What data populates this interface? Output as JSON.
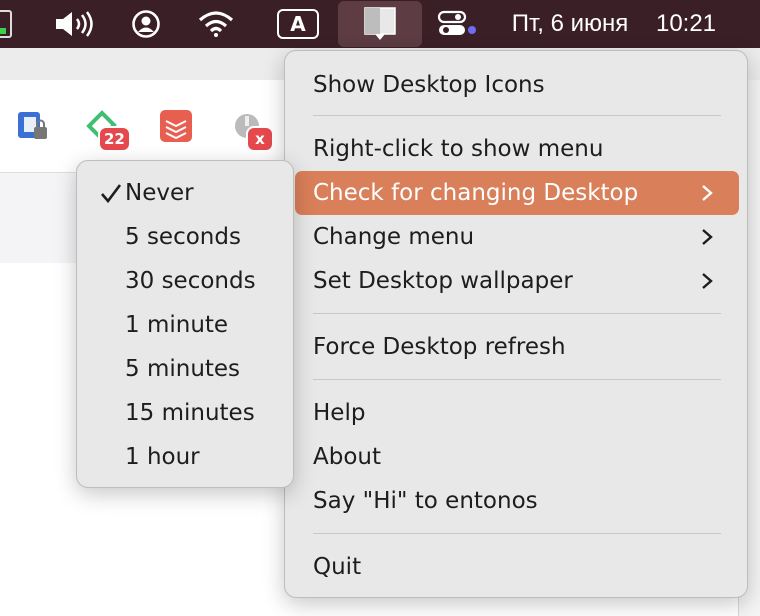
{
  "menubar": {
    "keyboard_indicator": "A",
    "date": "Пт, 6 июня",
    "time": "10:21",
    "icons": [
      "battery-icon",
      "volume-icon",
      "user-icon",
      "wifi-icon",
      "keyboard-layout-icon",
      "desktop-app-icon",
      "control-center-icon"
    ]
  },
  "extensions": {
    "badge_22": "22",
    "badge_x": "x"
  },
  "main_menu": {
    "items": [
      {
        "label": "Show Desktop Icons"
      },
      {
        "label": "Right-click to show menu"
      },
      {
        "label": "Check for changing Desktop",
        "submenu": true,
        "highlighted": true
      },
      {
        "label": "Change menu",
        "submenu": true
      },
      {
        "label": "Set Desktop wallpaper",
        "submenu": true
      },
      {
        "label": "Force Desktop refresh"
      },
      {
        "label": "Help"
      },
      {
        "label": "About"
      },
      {
        "label": "Say \"Hi\" to entonos"
      },
      {
        "label": "Quit"
      }
    ]
  },
  "sub_menu": {
    "items": [
      {
        "label": "Never",
        "checked": true
      },
      {
        "label": "5 seconds"
      },
      {
        "label": "30 seconds"
      },
      {
        "label": "1 minute"
      },
      {
        "label": "5 minutes"
      },
      {
        "label": "15 minutes"
      },
      {
        "label": "1 hour"
      }
    ]
  },
  "colors": {
    "menubar": "#3a1f26",
    "highlight": "#d97f59",
    "badge": "#e5484d"
  }
}
